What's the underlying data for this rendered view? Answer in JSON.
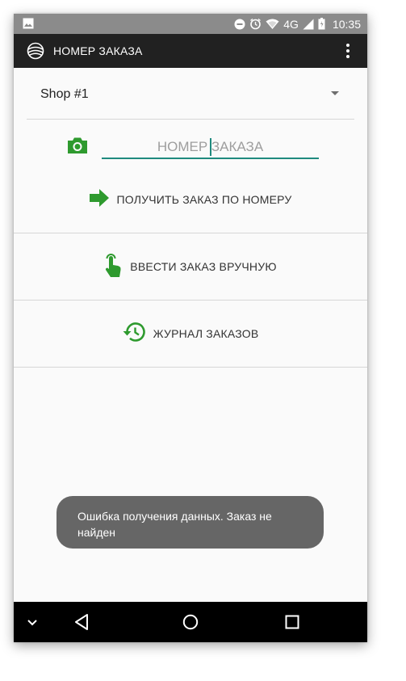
{
  "status_bar": {
    "network": "4G",
    "time": "10:35",
    "icons": [
      "image-icon",
      "dnd-icon",
      "alarm-icon",
      "wifi-icon",
      "signal-icon",
      "battery-icon"
    ]
  },
  "app_bar": {
    "title": "НОМЕР ЗАКАЗА",
    "menu_icon": "more-vert-icon"
  },
  "shop_select": {
    "value": "Shop #1"
  },
  "order_input": {
    "placeholder": "НОМЕР ЗАКАЗА",
    "value": ""
  },
  "actions": [
    {
      "label": "ПОЛУЧИТЬ ЗАКАЗ ПО НОМЕРУ",
      "icon": "arrow-right-icon"
    },
    {
      "label": "ВВЕСТИ ЗАКАЗ ВРУЧНУЮ",
      "icon": "touch-icon"
    },
    {
      "label": "ЖУРНАЛ ЗАКАЗОВ",
      "icon": "history-icon"
    }
  ],
  "toast": {
    "message": "Ошибка получения данных. Заказ не найден"
  },
  "colors": {
    "accent_green": "#2e9a2e",
    "input_underline": "#1f8a7e",
    "app_bar": "#212121",
    "status_bar": "#8b8b8b",
    "toast_bg": "#666666"
  }
}
